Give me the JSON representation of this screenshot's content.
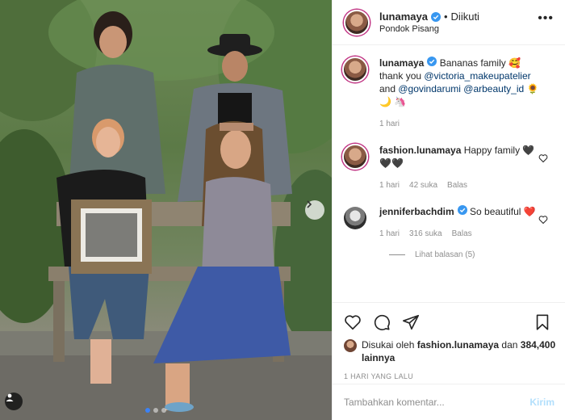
{
  "post": {
    "username": "lunamaya",
    "follow_status": "Diikuti",
    "separator": "•",
    "location": "Pondok Pisang",
    "photo_description_icon": "user-tag-icon"
  },
  "caption": {
    "username": "lunamaya",
    "text_1": " Bananas family 🥰 thank you ",
    "mention_1": "@victoria_makeupatelier",
    "text_2": " and ",
    "mention_2": "@govindarumi",
    "text_3": " ",
    "mention_3": "@arbeauty_id",
    "text_4": " 🌻🌙 🦄",
    "time": "1 hari"
  },
  "comments": [
    {
      "username": "fashion.lunamaya",
      "text": " Happy family 🖤🖤🖤",
      "time": "1 hari",
      "likes": "42 suka",
      "reply": "Balas"
    },
    {
      "username": "jenniferbachdim",
      "text": " So beautiful ❤️",
      "time": "1 hari",
      "likes": "316 suka",
      "reply": "Balas",
      "view_replies": "Lihat balasan (5)"
    }
  ],
  "likes": {
    "prefix": "Disukai oleh ",
    "user": "fashion.lunamaya",
    "middle": " dan ",
    "count": "384,400 lainnya"
  },
  "date": "1 HARI YANG LALU",
  "composer": {
    "placeholder": "Tambahkan komentar...",
    "post_label": "Kirim"
  },
  "colors": {
    "accent": "#0095f6",
    "post_disabled": "#b2dffc",
    "heart_red": "#ed4956",
    "mention": "#00376b"
  }
}
